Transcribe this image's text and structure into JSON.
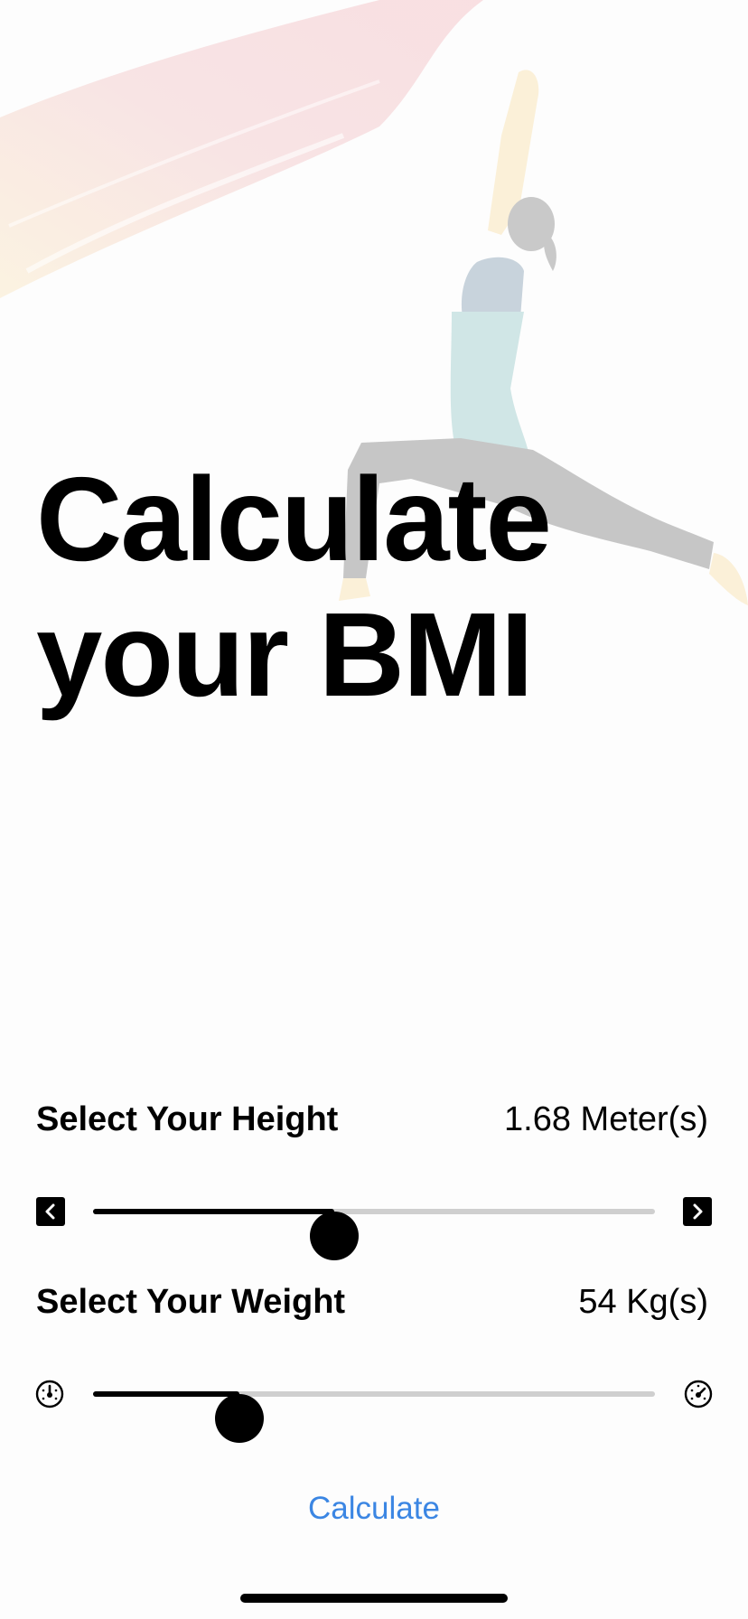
{
  "hero": {
    "title_line1": "Calculate",
    "title_line2": "your BMI"
  },
  "height": {
    "label": "Select Your Height",
    "value_text": "1.68 Meter(s)",
    "slider_fraction": 0.43,
    "left_icon": "chevron-left-square-icon",
    "right_icon": "chevron-right-square-icon"
  },
  "weight": {
    "label": "Select Your Weight",
    "value_text": "54 Kg(s)",
    "slider_fraction": 0.26,
    "left_icon": "gauge-low-icon",
    "right_icon": "gauge-high-icon"
  },
  "action": {
    "calculate_label": "Calculate"
  },
  "colors": {
    "accent": "#3b86e3",
    "slider_track": "#cfcfcf",
    "slider_fill": "#000000"
  }
}
